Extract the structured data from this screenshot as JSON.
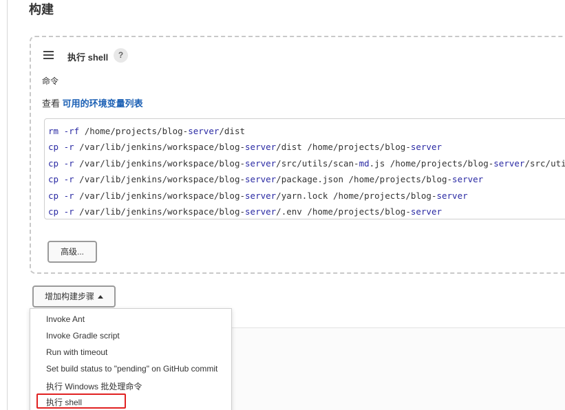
{
  "section": {
    "title": "构建"
  },
  "step": {
    "title": "执行 shell",
    "help": "?",
    "command_label": "命令",
    "env_prefix": "查看 ",
    "env_link": "可用的环境变量列表",
    "code_lines": [
      [
        {
          "t": "rm",
          "kw": true
        },
        {
          "t": " ",
          "kw": false
        },
        {
          "t": "-rf",
          "kw": true
        },
        {
          "t": " /home/projects/blog-",
          "kw": false
        },
        {
          "t": "server",
          "kw": true
        },
        {
          "t": "/dist",
          "kw": false
        }
      ],
      [
        {
          "t": "cp",
          "kw": true
        },
        {
          "t": " ",
          "kw": false
        },
        {
          "t": "-r",
          "kw": true
        },
        {
          "t": " /var/lib/jenkins/workspace/blog-",
          "kw": false
        },
        {
          "t": "server",
          "kw": true
        },
        {
          "t": "/dist /home/projects/blog-",
          "kw": false
        },
        {
          "t": "server",
          "kw": true
        }
      ],
      [
        {
          "t": "cp",
          "kw": true
        },
        {
          "t": " ",
          "kw": false
        },
        {
          "t": "-r",
          "kw": true
        },
        {
          "t": " /var/lib/jenkins/workspace/blog-",
          "kw": false
        },
        {
          "t": "server",
          "kw": true
        },
        {
          "t": "/src/utils/scan-",
          "kw": false
        },
        {
          "t": "md",
          "kw": true
        },
        {
          "t": ".js /home/projects/blog-",
          "kw": false
        },
        {
          "t": "server",
          "kw": true
        },
        {
          "t": "/src/uti",
          "kw": false
        }
      ],
      [
        {
          "t": "cp",
          "kw": true
        },
        {
          "t": " ",
          "kw": false
        },
        {
          "t": "-r",
          "kw": true
        },
        {
          "t": " /var/lib/jenkins/workspace/blog-",
          "kw": false
        },
        {
          "t": "server",
          "kw": true
        },
        {
          "t": "/package.json /home/projects/blog-",
          "kw": false
        },
        {
          "t": "server",
          "kw": true
        }
      ],
      [
        {
          "t": "cp",
          "kw": true
        },
        {
          "t": " ",
          "kw": false
        },
        {
          "t": "-r",
          "kw": true
        },
        {
          "t": " /var/lib/jenkins/workspace/blog-",
          "kw": false
        },
        {
          "t": "server",
          "kw": true
        },
        {
          "t": "/yarn.lock /home/projects/blog-",
          "kw": false
        },
        {
          "t": "server",
          "kw": true
        }
      ],
      [
        {
          "t": "cp",
          "kw": true
        },
        {
          "t": " ",
          "kw": false
        },
        {
          "t": "-r",
          "kw": true
        },
        {
          "t": " /var/lib/jenkins/workspace/blog-",
          "kw": false
        },
        {
          "t": "server",
          "kw": true
        },
        {
          "t": "/.env /home/projects/blog-",
          "kw": false
        },
        {
          "t": "server",
          "kw": true
        }
      ]
    ],
    "advanced_label": "高级..."
  },
  "add_step": {
    "label": "增加构建步骤"
  },
  "menu": {
    "items": [
      "Invoke Ant",
      "Invoke Gradle script",
      "Run with timeout",
      "Set build status to \"pending\" on GitHub commit",
      "执行 Windows 批处理命令",
      "执行 shell"
    ],
    "highlighted": "执行 shell"
  },
  "colors": {
    "keyword": "#2929a3",
    "link": "#1a5fb4",
    "highlight": "#e02020"
  }
}
